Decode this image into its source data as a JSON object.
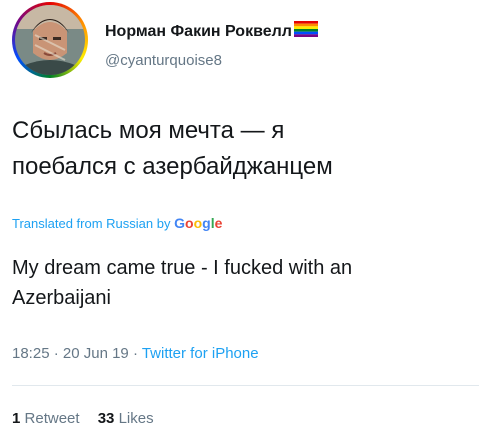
{
  "author": {
    "display_name": "Норман Факин Роквелл",
    "handle": "@cyanturquoise8",
    "name_suffix_icon": "rainbow-flag-icon"
  },
  "tweet": {
    "text_line_1": "Сбылась моя мечта — я",
    "text_line_2": "поебался с азербайджанцем",
    "translated_prefix": "Translated from Russian by",
    "translation_provider": {
      "G": "G",
      "o1": "o",
      "o2": "o",
      "g": "g",
      "l": "l",
      "e": "e"
    },
    "translation_line_1": "My dream came true - I fucked with an",
    "translation_line_2": "Azerbaijani"
  },
  "meta": {
    "time": "18:25",
    "sep1": " · ",
    "date": "20 Jun 19",
    "sep2": " · ",
    "source": "Twitter for iPhone"
  },
  "stats": {
    "retweets_count": "1",
    "retweets_label": "Retweet",
    "likes_count": "33",
    "likes_label": "Likes"
  },
  "colors": {
    "link": "#1da1f2",
    "secondary_text": "#657786",
    "primary_text": "#14171a",
    "divider": "#e1e8ed"
  }
}
